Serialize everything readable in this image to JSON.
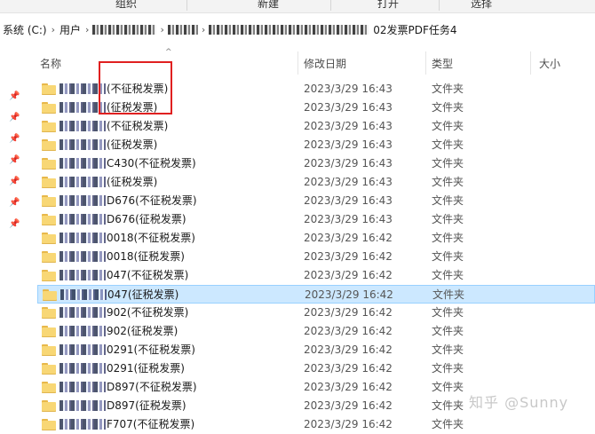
{
  "ribbon": {
    "organize": "组织",
    "new": "新建",
    "open": "打开",
    "select": "选择"
  },
  "address": {
    "crumbs": [
      "系统 (C:)",
      "用户"
    ],
    "tail": "02发票PDF任务4",
    "chevron": "›"
  },
  "columns": {
    "name": "名称",
    "modified": "修改日期",
    "type": "类型",
    "size": "大小"
  },
  "rows": [
    {
      "name": "(不征税发票)",
      "date": "2023/3/29 16:43",
      "type": "文件夹",
      "selected": false
    },
    {
      "name": "(征税发票)",
      "date": "2023/3/29 16:43",
      "type": "文件夹",
      "selected": false
    },
    {
      "name": "(不征税发票)",
      "date": "2023/3/29 16:43",
      "type": "文件夹",
      "selected": false
    },
    {
      "name": "(征税发票)",
      "date": "2023/3/29 16:43",
      "type": "文件夹",
      "selected": false
    },
    {
      "name": "C430(不征税发票)",
      "date": "2023/3/29 16:43",
      "type": "文件夹",
      "selected": false
    },
    {
      "name": "(征税发票)",
      "date": "2023/3/29 16:43",
      "type": "文件夹",
      "selected": false
    },
    {
      "name": "D676(不征税发票)",
      "date": "2023/3/29 16:43",
      "type": "文件夹",
      "selected": false
    },
    {
      "name": "D676(征税发票)",
      "date": "2023/3/29 16:43",
      "type": "文件夹",
      "selected": false
    },
    {
      "name": "0018(不征税发票)",
      "date": "2023/3/29 16:42",
      "type": "文件夹",
      "selected": false
    },
    {
      "name": "0018(征税发票)",
      "date": "2023/3/29 16:42",
      "type": "文件夹",
      "selected": false
    },
    {
      "name": "047(不征税发票)",
      "date": "2023/3/29 16:42",
      "type": "文件夹",
      "selected": false
    },
    {
      "name": "047(征税发票)",
      "date": "2023/3/29 16:42",
      "type": "文件夹",
      "selected": true
    },
    {
      "name": "902(不征税发票)",
      "date": "2023/3/29 16:42",
      "type": "文件夹",
      "selected": false
    },
    {
      "name": "902(征税发票)",
      "date": "2023/3/29 16:42",
      "type": "文件夹",
      "selected": false
    },
    {
      "name": "0291(不征税发票)",
      "date": "2023/3/29 16:42",
      "type": "文件夹",
      "selected": false
    },
    {
      "name": "0291(征税发票)",
      "date": "2023/3/29 16:42",
      "type": "文件夹",
      "selected": false
    },
    {
      "name": "D897(不征税发票)",
      "date": "2023/3/29 16:42",
      "type": "文件夹",
      "selected": false
    },
    {
      "name": "D897(征税发票)",
      "date": "2023/3/29 16:42",
      "type": "文件夹",
      "selected": false
    },
    {
      "name": "F707(不征税发票)",
      "date": "2023/3/29 16:42",
      "type": "文件夹",
      "selected": false
    }
  ],
  "watermark": "知乎 @Sunny",
  "colors": {
    "selection": "#cce8ff",
    "annotation": "#e02020",
    "folder": "#f8d775"
  }
}
